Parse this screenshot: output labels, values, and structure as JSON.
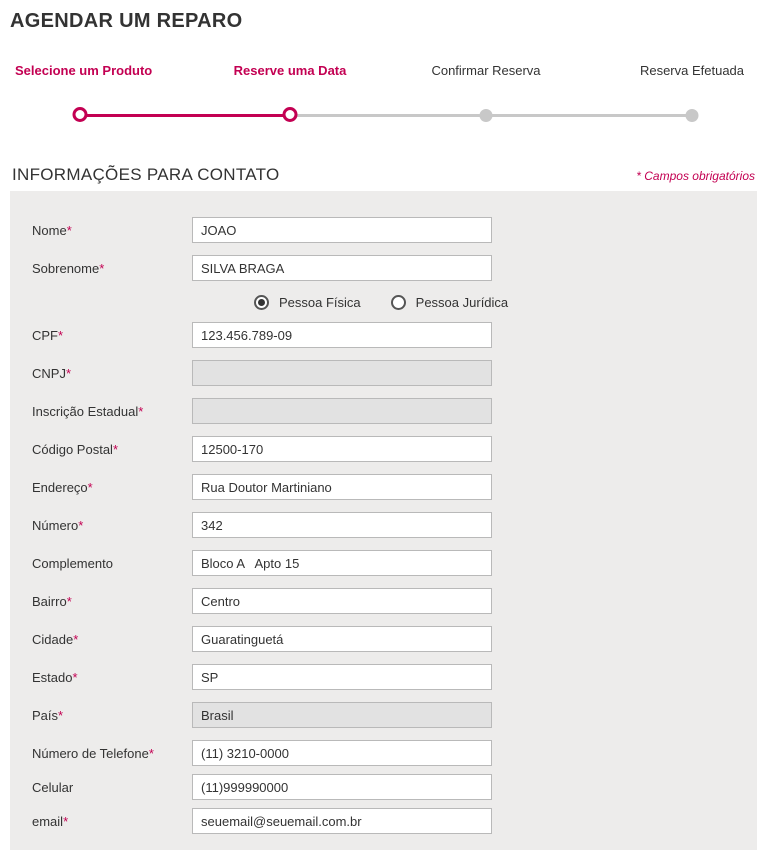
{
  "pageTitle": "AGENDAR UM REPARO",
  "stepper": {
    "step1": "Selecione um Produto",
    "step2": "Reserve uma Data",
    "step3": "Confirmar Reserva",
    "step4": "Reserva Efetuada"
  },
  "section": {
    "title": "INFORMAÇÕES PARA CONTATO",
    "requiredNote": "*  Campos obrigatórios"
  },
  "labels": {
    "nome": "Nome",
    "sobrenome": "Sobrenome",
    "pessoaFisica": "Pessoa Física",
    "pessoaJuridica": "Pessoa Jurídica",
    "cpf": "CPF",
    "cnpj": "CNPJ",
    "inscricaoEstadual": "Inscrição Estadual",
    "codigoPostal": "Código Postal",
    "endereco": "Endereço",
    "numero": "Número",
    "complemento": "Complemento",
    "bairro": "Bairro",
    "cidade": "Cidade",
    "estado": "Estado",
    "pais": "País",
    "telefone": "Número de Telefone",
    "celular": "Celular",
    "email": "email"
  },
  "values": {
    "nome": "JOAO",
    "sobrenome": "SILVA BRAGA",
    "cpf": "123.456.789-09",
    "cnpj": "",
    "inscricaoEstadual": "",
    "codigoPostal": "12500-170",
    "endereco": "Rua Doutor Martiniano",
    "numero": "342",
    "complemento": "Bloco A   Apto 15",
    "bairro": "Centro",
    "cidade": "Guaratinguetá",
    "estado": "SP",
    "pais": "Brasil",
    "telefone": "(11) 3210-0000",
    "celular": "(11)999990000",
    "email": "seuemail@seuemail.com.br"
  },
  "personType": "fisica"
}
